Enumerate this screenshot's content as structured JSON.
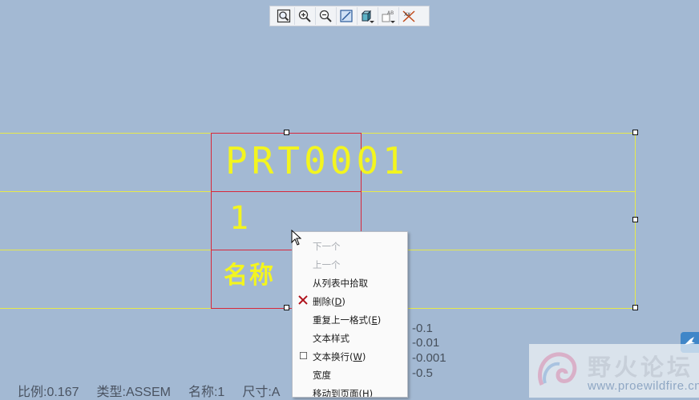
{
  "toolbar": {
    "buttons": [
      {
        "icon": "zoom-fit-icon"
      },
      {
        "icon": "zoom-in-icon"
      },
      {
        "icon": "zoom-out-icon"
      },
      {
        "icon": "repaint-icon"
      },
      {
        "icon": "display-style-icon",
        "has_dropdown": true
      },
      {
        "icon": "annotation-display-icon",
        "has_dropdown": true
      },
      {
        "icon": "datum-display-icon"
      }
    ]
  },
  "table": {
    "name_value": "PRT0001",
    "qty_value": "1",
    "label_value": "名称"
  },
  "context_menu": {
    "items": [
      {
        "label": "下一个",
        "enabled": false
      },
      {
        "label": "上一个",
        "enabled": false
      },
      {
        "label": "从列表中拾取",
        "enabled": true
      },
      {
        "label": "删除(",
        "accel": "D",
        "label_end": ")",
        "enabled": true,
        "icon": "delete-x-icon"
      },
      {
        "label": "重复上一格式(",
        "accel": "E",
        "label_end": ")",
        "enabled": true
      },
      {
        "label": "文本样式",
        "enabled": true
      },
      {
        "label": "文本换行(",
        "accel": "W",
        "label_end": ")",
        "enabled": true,
        "icon": "checkbox-icon"
      },
      {
        "label": "宽度",
        "enabled": true
      },
      {
        "label": "移动到页面(",
        "accel": "H",
        "label_end": ")",
        "enabled": true
      }
    ]
  },
  "tolerances": [
    "-0.1",
    "-0.01",
    "-0.001",
    "-0.5"
  ],
  "status_bar": {
    "scale": "比例:0.167",
    "type": "类型:ASSEM",
    "name": "名称:1",
    "size": "尺寸:A"
  },
  "watermark": {
    "title": "野火论坛",
    "url": "www.proewildfire.cn"
  },
  "colors": {
    "background": "#a3b9d3",
    "table_lines": "#e7e94a",
    "text_yellow": "#f3f51f",
    "selection_red": "#d8283b"
  }
}
